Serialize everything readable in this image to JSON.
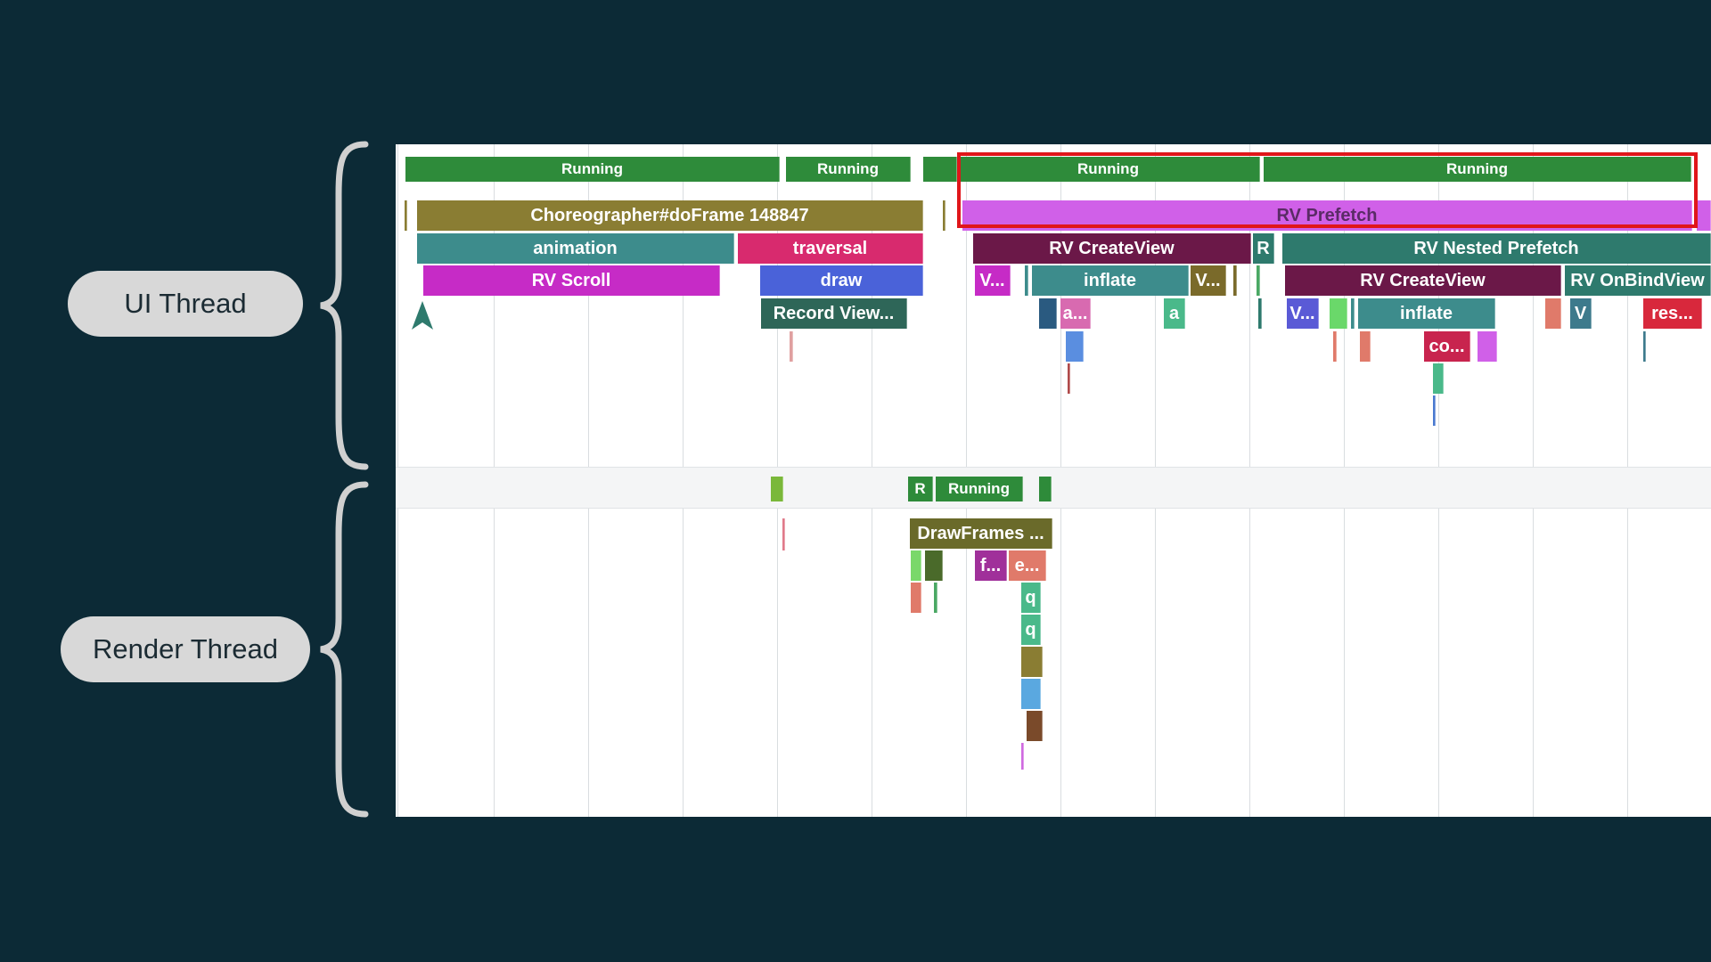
{
  "labels": {
    "ui_thread": "UI Thread",
    "render_thread": "Render Thread"
  },
  "colors": {
    "background": "#0c2a36",
    "running": "#2e8b3a",
    "highlight": "#e0161a"
  },
  "ui_thread": {
    "states": [
      "Running",
      "Running",
      "Running",
      "Running"
    ],
    "slices": {
      "choreographer": "Choreographer#doFrame 148847",
      "animation": "animation",
      "traversal": "traversal",
      "rv_scroll": "RV Scroll",
      "draw": "draw",
      "record_view": "Record View...",
      "rv_prefetch": "RV Prefetch",
      "rv_createview_1": "RV CreateView",
      "r_1": "R",
      "rv_nested_prefetch": "RV Nested Prefetch",
      "v_1": "V...",
      "inflate_1": "inflate",
      "v_2": "V...",
      "rv_createview_2": "RV CreateView",
      "rv_onbindview": "RV OnBindView",
      "a_1": "a...",
      "a_2": "a",
      "v_3": "V...",
      "inflate_2": "inflate",
      "v_4": "V",
      "res": "res...",
      "co": "co..."
    }
  },
  "render_thread": {
    "states": {
      "r": "R",
      "running": "Running"
    },
    "slices": {
      "drawframes": "DrawFrames ...",
      "f": "f...",
      "e": "e...",
      "q_1": "q",
      "q_2": "q"
    }
  }
}
